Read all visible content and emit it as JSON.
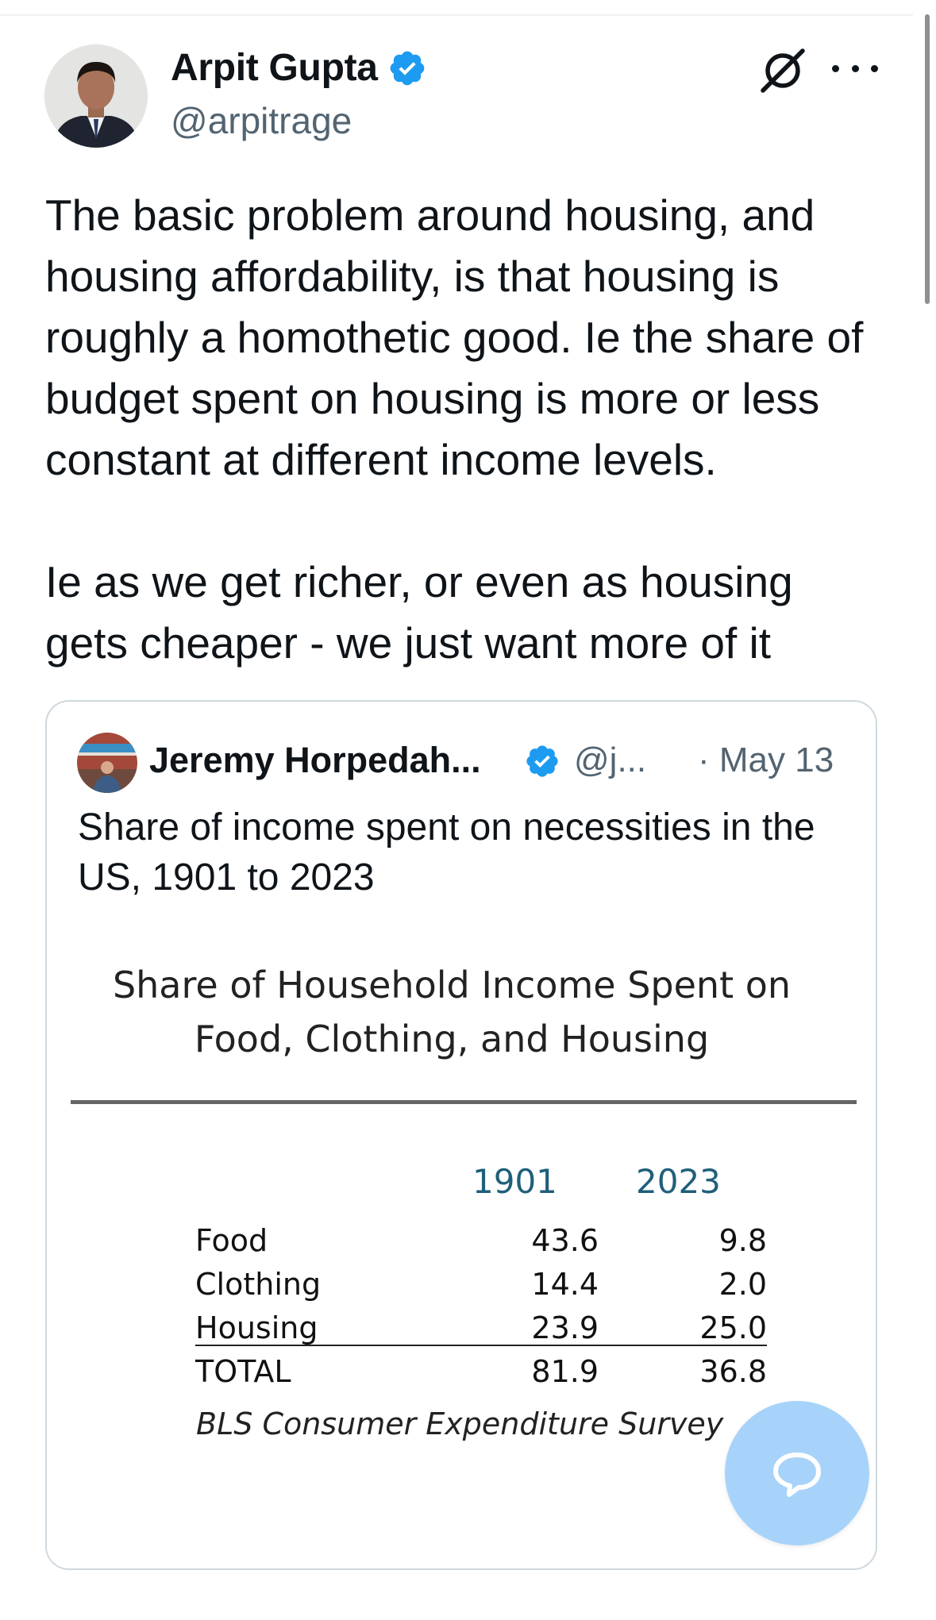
{
  "author": {
    "name": "Arpit Gupta",
    "handle": "@arpitrage"
  },
  "tweet": {
    "paragraphs": [
      "The basic problem around housing, and housing affordability, is that housing is roughly a homothetic good. Ie the share of budget spent on housing is more or less constant at different income levels.",
      "Ie as we get richer, or even as housing gets cheaper - we just want more of it"
    ]
  },
  "quote": {
    "author_name": "Jeremy Horpedah...",
    "author_handle": "@j...",
    "date": "· May 13",
    "text": "Share of income spent on necessities in the US, 1901 to 2023"
  },
  "chart_data": {
    "type": "table",
    "title_lines": [
      "Share of Household Income Spent on",
      "Food, Clothing, and Housing"
    ],
    "columns": [
      "1901",
      "2023"
    ],
    "rows": [
      {
        "label": "Food",
        "values": [
          "43.6",
          "9.8"
        ]
      },
      {
        "label": "Clothing",
        "values": [
          "14.4",
          "2.0"
        ]
      },
      {
        "label": "Housing",
        "values": [
          "23.9",
          "25.0"
        ]
      },
      {
        "label": "TOTAL",
        "values": [
          "81.9",
          "36.8"
        ]
      }
    ],
    "source": "BLS Consumer Expenditure Survey"
  },
  "colors": {
    "accent": "#1d9bf0",
    "secondary_text": "#536471",
    "fab_background": "#a7d3fa",
    "year_header": "#1f5f7a"
  },
  "icons": {
    "verified": "verified-badge-icon",
    "grok": "grok-icon",
    "more": "more-horizontal-icon",
    "compose": "chat-bubble-icon"
  }
}
